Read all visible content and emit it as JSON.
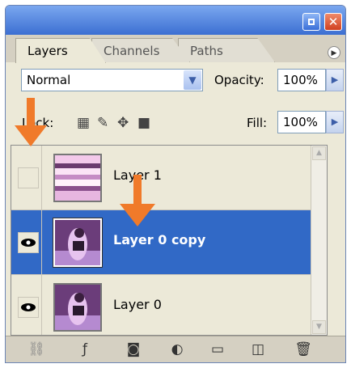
{
  "tabs": [
    {
      "label": "Layers",
      "active": true
    },
    {
      "label": "Channels",
      "active": false
    },
    {
      "label": "Paths",
      "active": false
    }
  ],
  "blend": {
    "mode": "Normal",
    "opacity_label": "Opacity:",
    "opacity_value": "100%"
  },
  "lock": {
    "label": "Lock:",
    "fill_label": "Fill:",
    "fill_value": "100%"
  },
  "layers": [
    {
      "name": "Layer 1",
      "visible": false,
      "selected": false
    },
    {
      "name": "Layer 0 copy",
      "visible": true,
      "selected": true
    },
    {
      "name": "Layer 0",
      "visible": true,
      "selected": false
    }
  ],
  "colors": {
    "selection": "#3169C6",
    "panel": "#ECE9D8",
    "annotation_arrow": "#F07A2A"
  },
  "icons": [
    "link-icon",
    "layer-style-icon",
    "layer-mask-icon",
    "adjustment-layer-icon",
    "new-group-icon",
    "new-layer-icon",
    "trash-icon"
  ]
}
